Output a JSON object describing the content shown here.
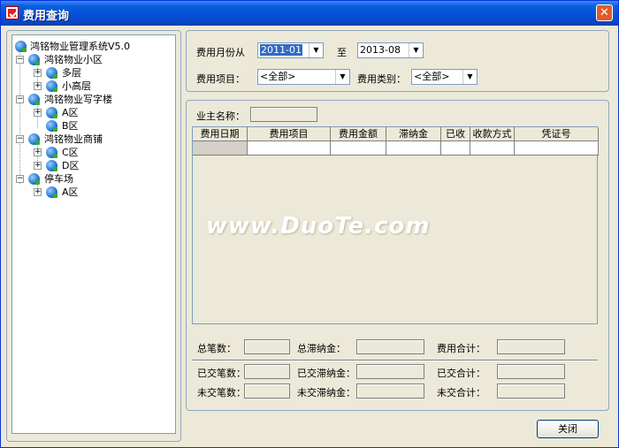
{
  "window": {
    "title": "费用查询",
    "close_glyph": "✕"
  },
  "tree": {
    "root": "鸿铭物业管理系统V5.0",
    "groups": [
      {
        "label": "鸿铭物业小区",
        "children": [
          "多层",
          "小高层"
        ]
      },
      {
        "label": "鸿铭物业写字楼",
        "children": [
          "A区",
          "B区"
        ]
      },
      {
        "label": "鸿铭物业商铺",
        "children": [
          "C区",
          "D区"
        ]
      },
      {
        "label": "停车场",
        "children": [
          "A区"
        ]
      }
    ]
  },
  "filters": {
    "month_from_label": "费用月份从",
    "month_from_value": "2011-01",
    "to_label": "至",
    "month_to_value": "2013-08",
    "item_label": "费用项目：",
    "item_value": "<全部>",
    "category_label": "费用类别：",
    "category_value": "<全部>"
  },
  "owner": {
    "label": "业主名称：",
    "value": ""
  },
  "table": {
    "columns": [
      "费用日期",
      "费用项目",
      "费用金额",
      "滞纳金",
      "已收",
      "收款方式",
      "凭证号"
    ],
    "rows": [
      [
        "",
        "",
        "",
        "",
        "",
        "",
        ""
      ]
    ]
  },
  "watermark": "www.DuoTe.com",
  "summary": {
    "total_count_label": "总笔数：",
    "total_late_fee_label": "总滞纳金：",
    "total_fee_label": "费用合计：",
    "paid_count_label": "已交笔数：",
    "paid_late_fee_label": "已交滞纳金：",
    "paid_total_label": "已交合计：",
    "unpaid_count_label": "未交笔数：",
    "unpaid_late_fee_label": "未交滞纳金：",
    "unpaid_total_label": "未交合计："
  },
  "buttons": {
    "close_label": "关闭"
  },
  "icons": {
    "tree_node": "globe-icon",
    "expand": "plus-icon",
    "collapse": "minus-icon",
    "app": "app-icon",
    "dropdown": "dropdown-arrow-icon"
  },
  "colors": {
    "titlebar": "#0550d8",
    "selection": "#316ac5",
    "window_bg": "#ece9d8"
  }
}
